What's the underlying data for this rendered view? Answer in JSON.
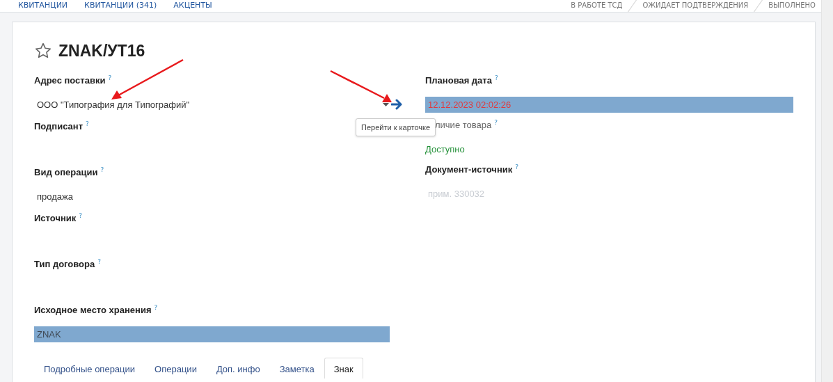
{
  "top_tabs": [
    {
      "label": "КВИТАНЦИИ"
    },
    {
      "label": "КВИТАНЦИИ (341)"
    },
    {
      "label": "АКЦЕНТЫ"
    }
  ],
  "status_steps": [
    {
      "label": "В РАБОТЕ ТСД"
    },
    {
      "label": "ОЖИДАЕТ ПОДТВЕРЖДЕНИЯ"
    },
    {
      "label": "ВЫПОЛНЕНО"
    }
  ],
  "record": {
    "title": "ZNAK/УТ16",
    "starred": false
  },
  "left_fields": [
    {
      "label": "Адрес поставки",
      "help": "?",
      "kind": "select",
      "value": "ООО \"Типография для Типографий\""
    },
    {
      "label": "Подписант",
      "help": "?",
      "kind": "empty"
    },
    {
      "label": "Вид операции",
      "help": "?",
      "kind": "text",
      "value": "продажа"
    },
    {
      "label": "Источник",
      "help": "?",
      "kind": "empty"
    },
    {
      "label": "Тип договора",
      "help": "?",
      "kind": "empty"
    },
    {
      "label": "Исходное место хранения",
      "help": "?",
      "kind": "highlight",
      "alert": false,
      "value": "ZNAK"
    }
  ],
  "right_fields": [
    {
      "label": "Плановая дата",
      "help": "?",
      "kind": "highlight",
      "alert": true,
      "value": "12.12.2023 02:02:26"
    },
    {
      "label": "личие товара",
      "help": "?",
      "kind": "status",
      "value": "Доступно",
      "covered": true
    },
    {
      "label": "Документ-источник",
      "help": "?",
      "kind": "input",
      "placeholder": "прим. 330032"
    }
  ],
  "tooltip": {
    "text": "Перейти к карточке"
  },
  "tabs": [
    {
      "label": "Подробные операции",
      "selected": false
    },
    {
      "label": "Операции",
      "selected": false
    },
    {
      "label": "Доп. инфо",
      "selected": false
    },
    {
      "label": "Заметка",
      "selected": false
    },
    {
      "label": "Знак",
      "selected": true
    }
  ]
}
